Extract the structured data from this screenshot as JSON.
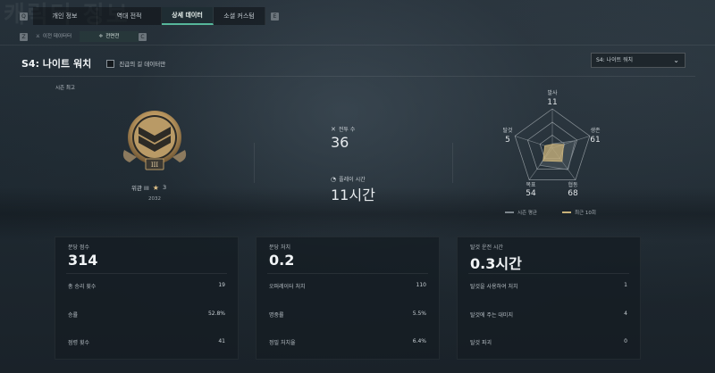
{
  "background_text": "캐릭터 정보",
  "nav": {
    "key_left": "Q",
    "key_right": "E",
    "tabs": [
      {
        "label": "개인 정보",
        "active": false
      },
      {
        "label": "역대 전적",
        "active": false
      },
      {
        "label": "상세 데이터",
        "active": true
      },
      {
        "label": "소셜 커스텀",
        "active": false
      }
    ]
  },
  "subnav": {
    "key_left": "Z",
    "key_right": "C",
    "tabs": [
      {
        "label": "이전 데이터터",
        "icon": "swords-icon",
        "active": false
      },
      {
        "label": "전면전",
        "icon": "crosshair-icon",
        "active": true
      }
    ]
  },
  "header": {
    "title": "S4: 나이트 워치",
    "checkbox_label": "진급의 길 데이터만",
    "season_select": "S4: 나이트 워치"
  },
  "season_best": {
    "label": "시즌 최고",
    "rank_name": "위관 III",
    "stars": "3",
    "rank_points": "2032",
    "medal_numeral": "III"
  },
  "battle": {
    "matches_label": "전투 수",
    "matches_value": "36",
    "playtime_label": "플레이 시간",
    "playtime_value": "11시간"
  },
  "radar": {
    "axes": [
      {
        "label": "발사",
        "value": "11"
      },
      {
        "label": "생존",
        "value": "61"
      },
      {
        "label": "협동",
        "value": "68"
      },
      {
        "label": "목표",
        "value": "54"
      },
      {
        "label": "탈것",
        "value": "5"
      }
    ],
    "series": [
      {
        "name": "시즌 평균",
        "values": [
          11,
          61,
          68,
          54,
          5
        ],
        "color": "#7d868d"
      },
      {
        "name": "최근 10회",
        "values": [
          10,
          30,
          42,
          40,
          20
        ],
        "color": "#c9b27a"
      }
    ]
  },
  "cards": [
    {
      "label": "분당 점수",
      "value": "314",
      "rows": [
        {
          "label": "총 승리 횟수",
          "value": "19"
        },
        {
          "label": "승률",
          "value": "52.8%"
        },
        {
          "label": "점령 횟수",
          "value": "41"
        }
      ]
    },
    {
      "label": "분당 처치",
      "value": "0.2",
      "rows": [
        {
          "label": "오퍼레이터 처치",
          "value": "110"
        },
        {
          "label": "명중률",
          "value": "5.5%"
        },
        {
          "label": "정밀 처치율",
          "value": "6.4%"
        }
      ]
    },
    {
      "label": "탈것 운전 시간",
      "value": "0.3시간",
      "rows": [
        {
          "label": "탈것을 사용하여 처치",
          "value": "1"
        },
        {
          "label": "탈것에 주는 대미지",
          "value": "4"
        },
        {
          "label": "탈것 파괴",
          "value": "0"
        }
      ]
    }
  ]
}
